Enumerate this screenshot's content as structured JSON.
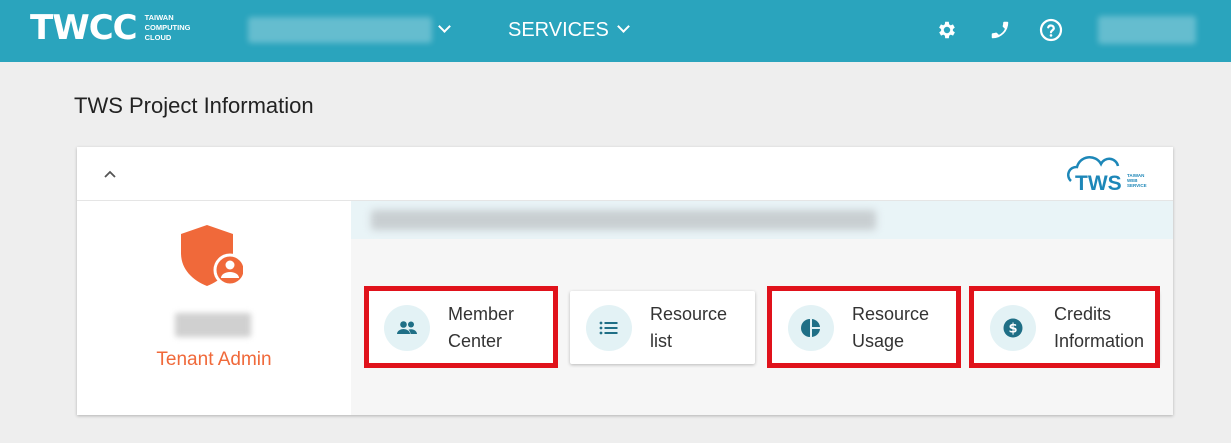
{
  "header": {
    "logo_mark": "TWCC",
    "logo_sub_lines": [
      "TAIWAN",
      "COMPUTING",
      "CLOUD"
    ],
    "services_label": "SERVICES",
    "icons": [
      "gear-icon",
      "phone-icon",
      "help-icon"
    ]
  },
  "page": {
    "title": "TWS Project Information"
  },
  "card": {
    "brand_logo": "TWS",
    "brand_logo_sub_lines": [
      "TAIWAN",
      "WEB",
      "SERVICE"
    ],
    "role": "Tenant Admin",
    "tiles": [
      {
        "line1": "Member",
        "line2": "Center",
        "icon": "people-icon",
        "highlighted": true
      },
      {
        "line1": "Resource",
        "line2": "list",
        "icon": "list-icon",
        "highlighted": false
      },
      {
        "line1": "Resource",
        "line2": "Usage",
        "icon": "pie-chart-icon",
        "highlighted": true
      },
      {
        "line1": "Credits",
        "line2": "Information",
        "icon": "dollar-circle-icon",
        "highlighted": true
      }
    ]
  },
  "colors": {
    "header_bg": "#2aa4bd",
    "accent_orange": "#f0693a",
    "icon_teal": "#1f6f86",
    "highlight_red": "#e0121b"
  }
}
